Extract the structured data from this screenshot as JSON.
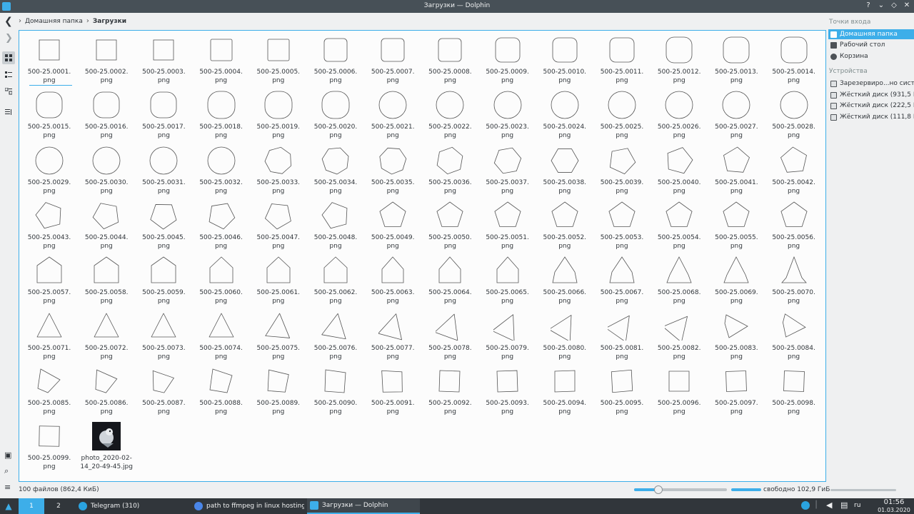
{
  "window": {
    "title": "Загрузки — Dolphin",
    "buttons": [
      "?",
      "⌄",
      "◇",
      "✕"
    ]
  },
  "breadcrumb": {
    "home": "Домашняя папка",
    "current": "Загрузки"
  },
  "files": [
    {
      "name1": "500-25.0001.",
      "name2": "png",
      "shape": "square",
      "angle": 0
    },
    {
      "name1": "500-25.0002.",
      "name2": "png",
      "shape": "square",
      "angle": 0
    },
    {
      "name1": "500-25.0003.",
      "name2": "png",
      "shape": "square",
      "angle": 0
    },
    {
      "name1": "500-25.0004.",
      "name2": "png",
      "shape": "rsq1",
      "angle": 0
    },
    {
      "name1": "500-25.0005.",
      "name2": "png",
      "shape": "rsq1",
      "angle": 0
    },
    {
      "name1": "500-25.0006.",
      "name2": "png",
      "shape": "rsq2",
      "angle": 0
    },
    {
      "name1": "500-25.0007.",
      "name2": "png",
      "shape": "rsq2",
      "angle": 0
    },
    {
      "name1": "500-25.0008.",
      "name2": "png",
      "shape": "rsq2",
      "angle": 0
    },
    {
      "name1": "500-25.0009.",
      "name2": "png",
      "shape": "rsq3",
      "angle": 0
    },
    {
      "name1": "500-25.0010.",
      "name2": "png",
      "shape": "rsq3",
      "angle": 0
    },
    {
      "name1": "500-25.0011.",
      "name2": "png",
      "shape": "rsq3",
      "angle": 0
    },
    {
      "name1": "500-25.0012.",
      "name2": "png",
      "shape": "rsq4",
      "angle": 0
    },
    {
      "name1": "500-25.0013.",
      "name2": "png",
      "shape": "rsq4",
      "angle": 0
    },
    {
      "name1": "500-25.0014.",
      "name2": "png",
      "shape": "rsq4",
      "angle": 0
    },
    {
      "name1": "500-25.0015.",
      "name2": "png",
      "shape": "rsq5",
      "angle": 0
    },
    {
      "name1": "500-25.0016.",
      "name2": "png",
      "shape": "rsq5",
      "angle": 0
    },
    {
      "name1": "500-25.0017.",
      "name2": "png",
      "shape": "rsq5",
      "angle": 0
    },
    {
      "name1": "500-25.0018.",
      "name2": "png",
      "shape": "rsq6",
      "angle": 0
    },
    {
      "name1": "500-25.0019.",
      "name2": "png",
      "shape": "rsq6",
      "angle": 0
    },
    {
      "name1": "500-25.0020.",
      "name2": "png",
      "shape": "rsq6",
      "angle": 0
    },
    {
      "name1": "500-25.0021.",
      "name2": "png",
      "shape": "circle",
      "angle": 0
    },
    {
      "name1": "500-25.0022.",
      "name2": "png",
      "shape": "circle",
      "angle": 0
    },
    {
      "name1": "500-25.0023.",
      "name2": "png",
      "shape": "circle",
      "angle": 0
    },
    {
      "name1": "500-25.0024.",
      "name2": "png",
      "shape": "circle",
      "angle": 0
    },
    {
      "name1": "500-25.0025.",
      "name2": "png",
      "shape": "circle",
      "angle": 0
    },
    {
      "name1": "500-25.0026.",
      "name2": "png",
      "shape": "circle",
      "angle": 0
    },
    {
      "name1": "500-25.0027.",
      "name2": "png",
      "shape": "circle",
      "angle": 0
    },
    {
      "name1": "500-25.0028.",
      "name2": "png",
      "shape": "circle",
      "angle": 0
    },
    {
      "name1": "500-25.0029.",
      "name2": "png",
      "shape": "circle",
      "angle": 0
    },
    {
      "name1": "500-25.0030.",
      "name2": "png",
      "shape": "circle",
      "angle": 0
    },
    {
      "name1": "500-25.0031.",
      "name2": "png",
      "shape": "circle",
      "angle": 0
    },
    {
      "name1": "500-25.0032.",
      "name2": "png",
      "shape": "circle",
      "angle": 0
    },
    {
      "name1": "500-25.0033.",
      "name2": "png",
      "shape": "poly7",
      "angle": 10
    },
    {
      "name1": "500-25.0034.",
      "name2": "png",
      "shape": "poly7",
      "angle": 20
    },
    {
      "name1": "500-25.0035.",
      "name2": "png",
      "shape": "poly7",
      "angle": 30
    },
    {
      "name1": "500-25.0036.",
      "name2": "png",
      "shape": "poly6",
      "angle": 10
    },
    {
      "name1": "500-25.0037.",
      "name2": "png",
      "shape": "poly6",
      "angle": 20
    },
    {
      "name1": "500-25.0038.",
      "name2": "png",
      "shape": "poly6",
      "angle": 30
    },
    {
      "name1": "500-25.0039.",
      "name2": "png",
      "shape": "poly5",
      "angle": 25
    },
    {
      "name1": "500-25.0040.",
      "name2": "png",
      "shape": "poly5",
      "angle": 15
    },
    {
      "name1": "500-25.0041.",
      "name2": "png",
      "shape": "poly5",
      "angle": 5
    },
    {
      "name1": "500-25.0042.",
      "name2": "png",
      "shape": "poly5",
      "angle": -5
    },
    {
      "name1": "500-25.0043.",
      "name2": "png",
      "shape": "poly5",
      "angle": -15
    },
    {
      "name1": "500-25.0044.",
      "name2": "png",
      "shape": "poly5",
      "angle": -25
    },
    {
      "name1": "500-25.0045.",
      "name2": "png",
      "shape": "poly5",
      "angle": -35
    },
    {
      "name1": "500-25.0046.",
      "name2": "png",
      "shape": "poly5",
      "angle": -45
    },
    {
      "name1": "500-25.0047.",
      "name2": "png",
      "shape": "poly5",
      "angle": -30
    },
    {
      "name1": "500-25.0048.",
      "name2": "png",
      "shape": "poly5",
      "angle": -15
    },
    {
      "name1": "500-25.0049.",
      "name2": "png",
      "shape": "poly5",
      "angle": 0
    },
    {
      "name1": "500-25.0050.",
      "name2": "png",
      "shape": "poly5",
      "angle": 0
    },
    {
      "name1": "500-25.0051.",
      "name2": "png",
      "shape": "poly5",
      "angle": 0
    },
    {
      "name1": "500-25.0052.",
      "name2": "png",
      "shape": "poly5",
      "angle": 0
    },
    {
      "name1": "500-25.0053.",
      "name2": "png",
      "shape": "poly5",
      "angle": 0
    },
    {
      "name1": "500-25.0054.",
      "name2": "png",
      "shape": "poly5",
      "angle": 0
    },
    {
      "name1": "500-25.0055.",
      "name2": "png",
      "shape": "poly5",
      "angle": 0
    },
    {
      "name1": "500-25.0056.",
      "name2": "png",
      "shape": "poly5",
      "angle": 0
    },
    {
      "name1": "500-25.0057.",
      "name2": "png",
      "shape": "house1",
      "angle": 0
    },
    {
      "name1": "500-25.0058.",
      "name2": "png",
      "shape": "house1",
      "angle": 0
    },
    {
      "name1": "500-25.0059.",
      "name2": "png",
      "shape": "house1",
      "angle": 0
    },
    {
      "name1": "500-25.0060.",
      "name2": "png",
      "shape": "house2",
      "angle": 0
    },
    {
      "name1": "500-25.0061.",
      "name2": "png",
      "shape": "house2",
      "angle": 0
    },
    {
      "name1": "500-25.0062.",
      "name2": "png",
      "shape": "house2",
      "angle": 0
    },
    {
      "name1": "500-25.0063.",
      "name2": "png",
      "shape": "house3",
      "angle": 0
    },
    {
      "name1": "500-25.0064.",
      "name2": "png",
      "shape": "house3",
      "angle": 0
    },
    {
      "name1": "500-25.0065.",
      "name2": "png",
      "shape": "house3",
      "angle": 0
    },
    {
      "name1": "500-25.0066.",
      "name2": "png",
      "shape": "house4",
      "angle": 0
    },
    {
      "name1": "500-25.0067.",
      "name2": "png",
      "shape": "house4",
      "angle": 0
    },
    {
      "name1": "500-25.0068.",
      "name2": "png",
      "shape": "house5",
      "angle": 0
    },
    {
      "name1": "500-25.0069.",
      "name2": "png",
      "shape": "house5",
      "angle": 0
    },
    {
      "name1": "500-25.0070.",
      "name2": "png",
      "shape": "house6",
      "angle": 0
    },
    {
      "name1": "500-25.0071.",
      "name2": "png",
      "shape": "tri",
      "angle": 0
    },
    {
      "name1": "500-25.0072.",
      "name2": "png",
      "shape": "tri",
      "angle": 0
    },
    {
      "name1": "500-25.0073.",
      "name2": "png",
      "shape": "tri",
      "angle": 0
    },
    {
      "name1": "500-25.0074.",
      "name2": "png",
      "shape": "tri",
      "angle": 0
    },
    {
      "name1": "500-25.0075.",
      "name2": "png",
      "shape": "tri",
      "angle": 5
    },
    {
      "name1": "500-25.0076.",
      "name2": "png",
      "shape": "tri",
      "angle": 10
    },
    {
      "name1": "500-25.0077.",
      "name2": "png",
      "shape": "tri",
      "angle": 15
    },
    {
      "name1": "500-25.0078.",
      "name2": "png",
      "shape": "tri",
      "angle": 20
    },
    {
      "name1": "500-25.0079.",
      "name2": "png",
      "shape": "tri",
      "angle": 25
    },
    {
      "name1": "500-25.0080.",
      "name2": "png",
      "shape": "tri",
      "angle": 30
    },
    {
      "name1": "500-25.0081.",
      "name2": "png",
      "shape": "tri",
      "angle": 35
    },
    {
      "name1": "500-25.0082.",
      "name2": "png",
      "shape": "tri",
      "angle": 40
    },
    {
      "name1": "500-25.0083.",
      "name2": "png",
      "shape": "quad1",
      "angle": 0
    },
    {
      "name1": "500-25.0084.",
      "name2": "png",
      "shape": "quad1",
      "angle": 5
    },
    {
      "name1": "500-25.0085.",
      "name2": "png",
      "shape": "quad2",
      "angle": 0
    },
    {
      "name1": "500-25.0086.",
      "name2": "png",
      "shape": "quad2",
      "angle": -5
    },
    {
      "name1": "500-25.0087.",
      "name2": "png",
      "shape": "quad2",
      "angle": -10
    },
    {
      "name1": "500-25.0088.",
      "name2": "png",
      "shape": "quad3",
      "angle": 0
    },
    {
      "name1": "500-25.0089.",
      "name2": "png",
      "shape": "quad3",
      "angle": -5
    },
    {
      "name1": "500-25.0090.",
      "name2": "png",
      "shape": "quad4",
      "angle": 0
    },
    {
      "name1": "500-25.0091.",
      "name2": "png",
      "shape": "quad4",
      "angle": -5
    },
    {
      "name1": "500-25.0092.",
      "name2": "png",
      "shape": "quad5",
      "angle": 0
    },
    {
      "name1": "500-25.0093.",
      "name2": "png",
      "shape": "quad5",
      "angle": -4
    },
    {
      "name1": "500-25.0094.",
      "name2": "png",
      "shape": "quad6",
      "angle": 0
    },
    {
      "name1": "500-25.0095.",
      "name2": "png",
      "shape": "quad6",
      "angle": -3
    },
    {
      "name1": "500-25.0096.",
      "name2": "png",
      "shape": "quad7",
      "angle": 0
    },
    {
      "name1": "500-25.0097.",
      "name2": "png",
      "shape": "quad7",
      "angle": -2
    },
    {
      "name1": "500-25.0098.",
      "name2": "png",
      "shape": "square",
      "angle": 2
    },
    {
      "name1": "500-25.0099.",
      "name2": "png",
      "shape": "square",
      "angle": 1
    },
    {
      "name1": "photo_2020-02-",
      "name2": "14_20-49-45.jpg",
      "shape": "photo",
      "angle": 0
    }
  ],
  "status": {
    "count": "100 файлов (862,4 КиБ)",
    "free": "свободно 102,9 ГиБ",
    "zoom_fraction": 0.26,
    "used_fraction": 0.32
  },
  "places": {
    "entry_header": "Точки входа",
    "entries": [
      {
        "label": "Домашняя папка",
        "icon": "home-folder-icon",
        "active": true
      },
      {
        "label": "Рабочий стол",
        "icon": "desktop-icon",
        "active": false
      },
      {
        "label": "Корзина",
        "icon": "trash-icon",
        "active": false
      }
    ],
    "devices_header": "Устройства",
    "devices": [
      {
        "label": "Зарезервиро...но систе",
        "icon": "drive-icon"
      },
      {
        "label": "Жёсткий диск (931,5 Ги",
        "icon": "drive-icon"
      },
      {
        "label": "Жёсткий диск (222,5 Ги",
        "icon": "drive-icon"
      },
      {
        "label": "Жёсткий диск (111,8 Ги",
        "icon": "drive-icon"
      }
    ]
  },
  "taskbar": {
    "desktops": [
      "1",
      "2"
    ],
    "tasks": [
      {
        "label": "Telegram (310)",
        "icon": "telegram-icon",
        "color": "#2aa3e0"
      },
      {
        "label": "path to ffmpeg in linux hosting ...",
        "icon": "chrome-icon",
        "color": "#4a86e8"
      },
      {
        "label": "Загрузки — Dolphin",
        "icon": "dolphin-icon",
        "color": "#3daee9"
      }
    ],
    "lang": "ru",
    "time": "01:56",
    "date": "01.03.2020"
  },
  "colors": {
    "accent": "#3daee9",
    "titlebar": "#475057",
    "taskbar": "#31363b"
  }
}
